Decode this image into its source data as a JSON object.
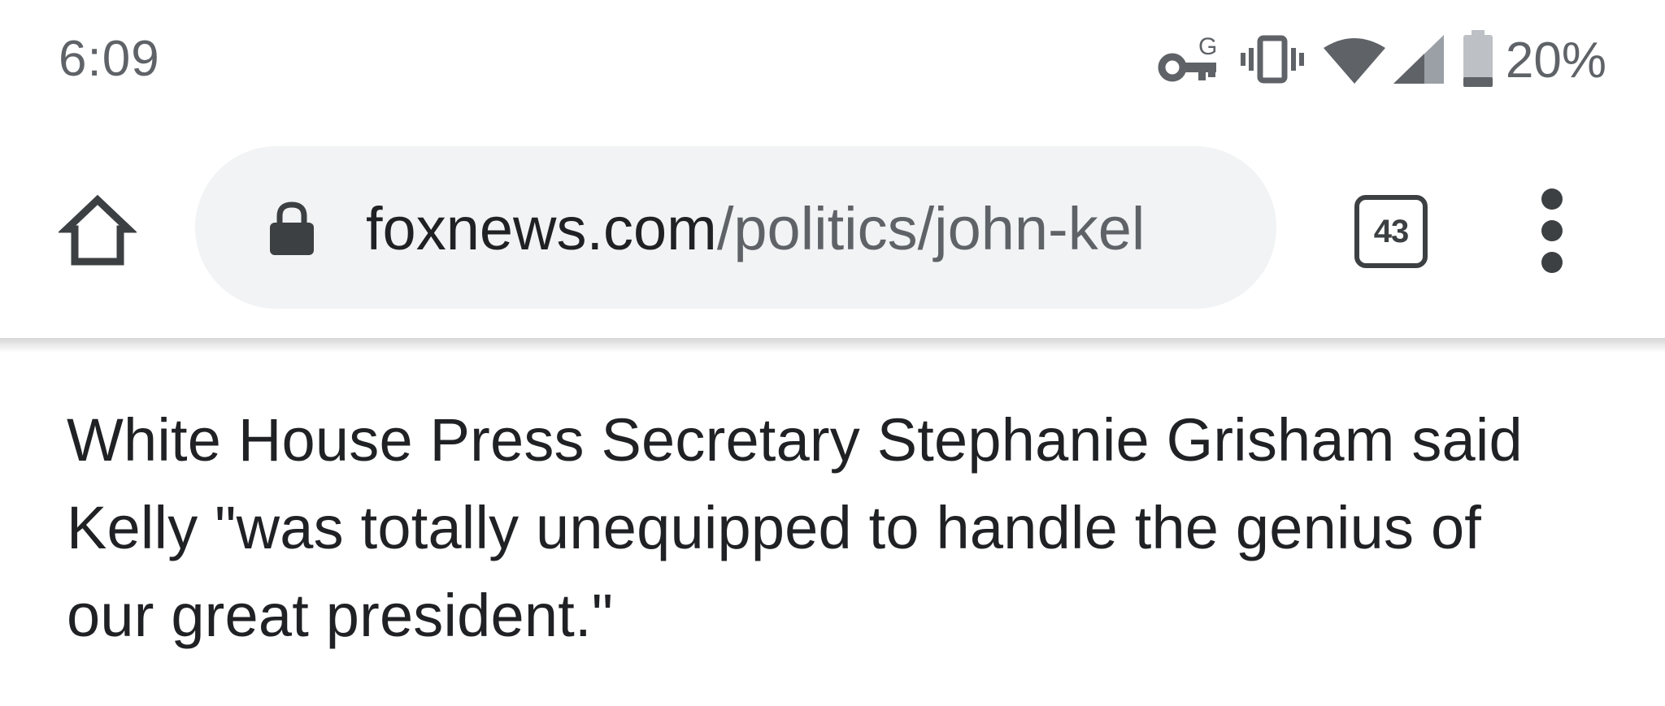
{
  "status_bar": {
    "time": "6:09",
    "icons": [
      "vpn-key-icon",
      "vibrate-icon",
      "wifi-icon",
      "cell-signal-icon",
      "battery-icon"
    ],
    "vpn_badge": "G",
    "battery_percent": "20%"
  },
  "toolbar": {
    "home_icon": "home-icon",
    "lock_icon": "lock-icon",
    "url_domain": "foxnews.com",
    "url_path": "/politics/john-kel",
    "tab_count": "43",
    "menu_icon": "more-vert-icon"
  },
  "article": {
    "lines": [
      "White House Press Secretary Stephanie Grisham said",
      "Kelly \"was totally unequipped to handle the genius of",
      "our great president.\""
    ]
  },
  "colors": {
    "omnibox_bg": "#f1f3f4",
    "text_primary": "#202124",
    "text_secondary": "#5f6368",
    "icon_dark": "#3c4043"
  }
}
